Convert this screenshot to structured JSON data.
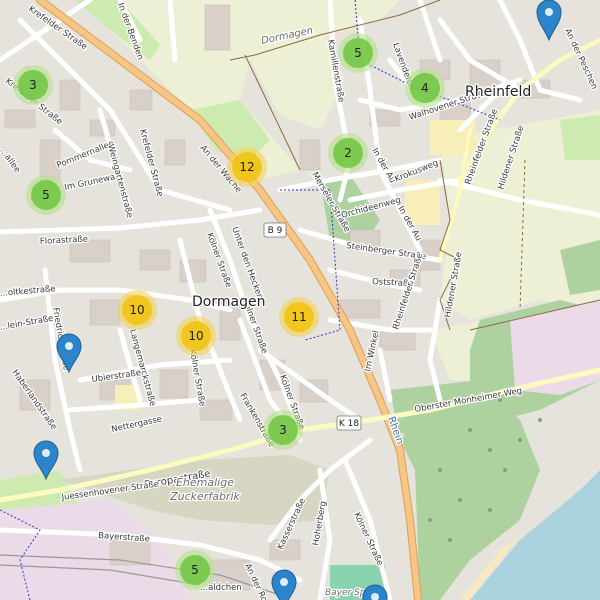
{
  "places": {
    "dormagen_center": "Dormagen",
    "dormagen_top": "Dormagen",
    "rheinfeld": "Rheinfeld"
  },
  "areas": {
    "zuckerfabrik_1": "Ehemalige",
    "zuckerfabrik_2": "Zuckerfabrik",
    "rhein": "Rhein",
    "bayer": "Bayer Spo..."
  },
  "road_refs": {
    "b9": "B 9",
    "k18": "K 18"
  },
  "streets": {
    "krefelder_1": "Krefelder Straße",
    "krefelder_2": "Krefelder Straße",
    "in_der_benden": "In der Benden",
    "pommernallee": "Pommernallee",
    "im_grunewald": "Im Grunewald",
    "weingartenstr": "Weingartenstraße",
    "an_der_wache": "An der Wache",
    "florastr": "Florastraße",
    "koelner_1": "Kölner Straße",
    "unter_den_hecken": "Unter den Hecken",
    "koelner_2": "Kölner Straße",
    "koelner_3": "Kölner Straße",
    "koelner_4": "Kölner Straße",
    "friedrichstr": "Friedrichstraße",
    "langemarckstr": "Langemarckstraße",
    "ubierstr": "Ubierstraße",
    "haberlandstr": "Haberlandstraße",
    "nettergasse": "Nettergasse",
    "frankenstr": "Frankenstraße",
    "europastr": "Europastraße",
    "juessenhovener": "Juessenhovener Straße",
    "bayerstr": "Bayerstraße",
    "kasserstr": "Kasserstraße",
    "hoherberg": "Hoherberg",
    "koelner_5": "Kölner Straße",
    "kamillenstr": "Kamillenstraße",
    "lavendelstr": "Lavendelstr.",
    "walhovener": "Walhovener Straße",
    "in_der_au_1": "In der Au",
    "in_der_au_2": "In der Au",
    "krokusweg": "Krokusweg",
    "merseler": "Merseler Straße",
    "orchideenweg": "Orchideenweg",
    "steinberger": "Steinberger Straße",
    "oststr": "Oststraße",
    "rheinfelder_1": "Rheinfelder Straße",
    "rheinfelder_2": "Rheinfelder Straße",
    "hildener_1": "Hildener Straße",
    "hildener_2": "Hildener Straße",
    "im_winkel": "Im Winkel",
    "obere_monheimer": "Oberster Monheimer Weg",
    "an_der_peschen": "An der Peschen",
    "leinstr": "...lein-Straße",
    "oltkestr": "...oltkestraße",
    "allee": "...allee",
    "walchen": "...aldchen",
    "an_der": "An der Ro..."
  },
  "clusters": [
    {
      "count": "3",
      "level": "green"
    },
    {
      "count": "5",
      "level": "green"
    },
    {
      "count": "5",
      "level": "green"
    },
    {
      "count": "4",
      "level": "green"
    },
    {
      "count": "2",
      "level": "green"
    },
    {
      "count": "12",
      "level": "yellow"
    },
    {
      "count": "10",
      "level": "yellow"
    },
    {
      "count": "10",
      "level": "yellow"
    },
    {
      "count": "11",
      "level": "yellow"
    },
    {
      "count": "3",
      "level": "green"
    },
    {
      "count": "5",
      "level": "green"
    }
  ],
  "colors": {
    "cluster_green_fill": "#6fc53f",
    "cluster_green_halo": "#b5e28c",
    "cluster_yellow_fill": "#f0c20c",
    "cluster_yellow_halo": "#f1d357",
    "marker_blue": "#2c84cb",
    "main_road": "#f7c586",
    "river": "#aad3df",
    "forest": "#aed1a0",
    "farmland": "#eef0d5",
    "industrial": "#ebdbe8"
  },
  "icons": {
    "marker": "map-pin-icon",
    "cluster": "cluster-bubble-icon"
  }
}
